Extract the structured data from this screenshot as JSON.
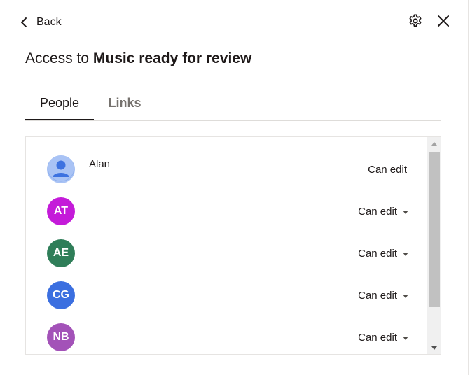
{
  "header": {
    "back_label": "Back",
    "settings_icon": "gear-icon",
    "close_icon": "close-icon"
  },
  "title": {
    "prefix": "Access to ",
    "item_name": "Music ready for review"
  },
  "tabs": [
    {
      "label": "People",
      "active": true
    },
    {
      "label": "Links",
      "active": false
    }
  ],
  "people": [
    {
      "name": "Alan",
      "initials": "",
      "avatar": "user-photo",
      "color": "#a9c3f5",
      "permission": "Can edit",
      "has_dropdown": false
    },
    {
      "name": "",
      "initials": "AT",
      "avatar": "initials",
      "color": "#c41bd9",
      "permission": "Can edit",
      "has_dropdown": true
    },
    {
      "name": "",
      "initials": "AE",
      "avatar": "initials",
      "color": "#2f7e59",
      "permission": "Can edit",
      "has_dropdown": true
    },
    {
      "name": "",
      "initials": "CG",
      "avatar": "initials",
      "color": "#3b6fe0",
      "permission": "Can edit",
      "has_dropdown": true
    },
    {
      "name": "",
      "initials": "NB",
      "avatar": "initials",
      "color": "#a352b8",
      "permission": "Can edit",
      "has_dropdown": true
    }
  ],
  "colors": {
    "text": "#1e1919",
    "muted_tab": "#76726e",
    "divider": "#dedcd9"
  }
}
